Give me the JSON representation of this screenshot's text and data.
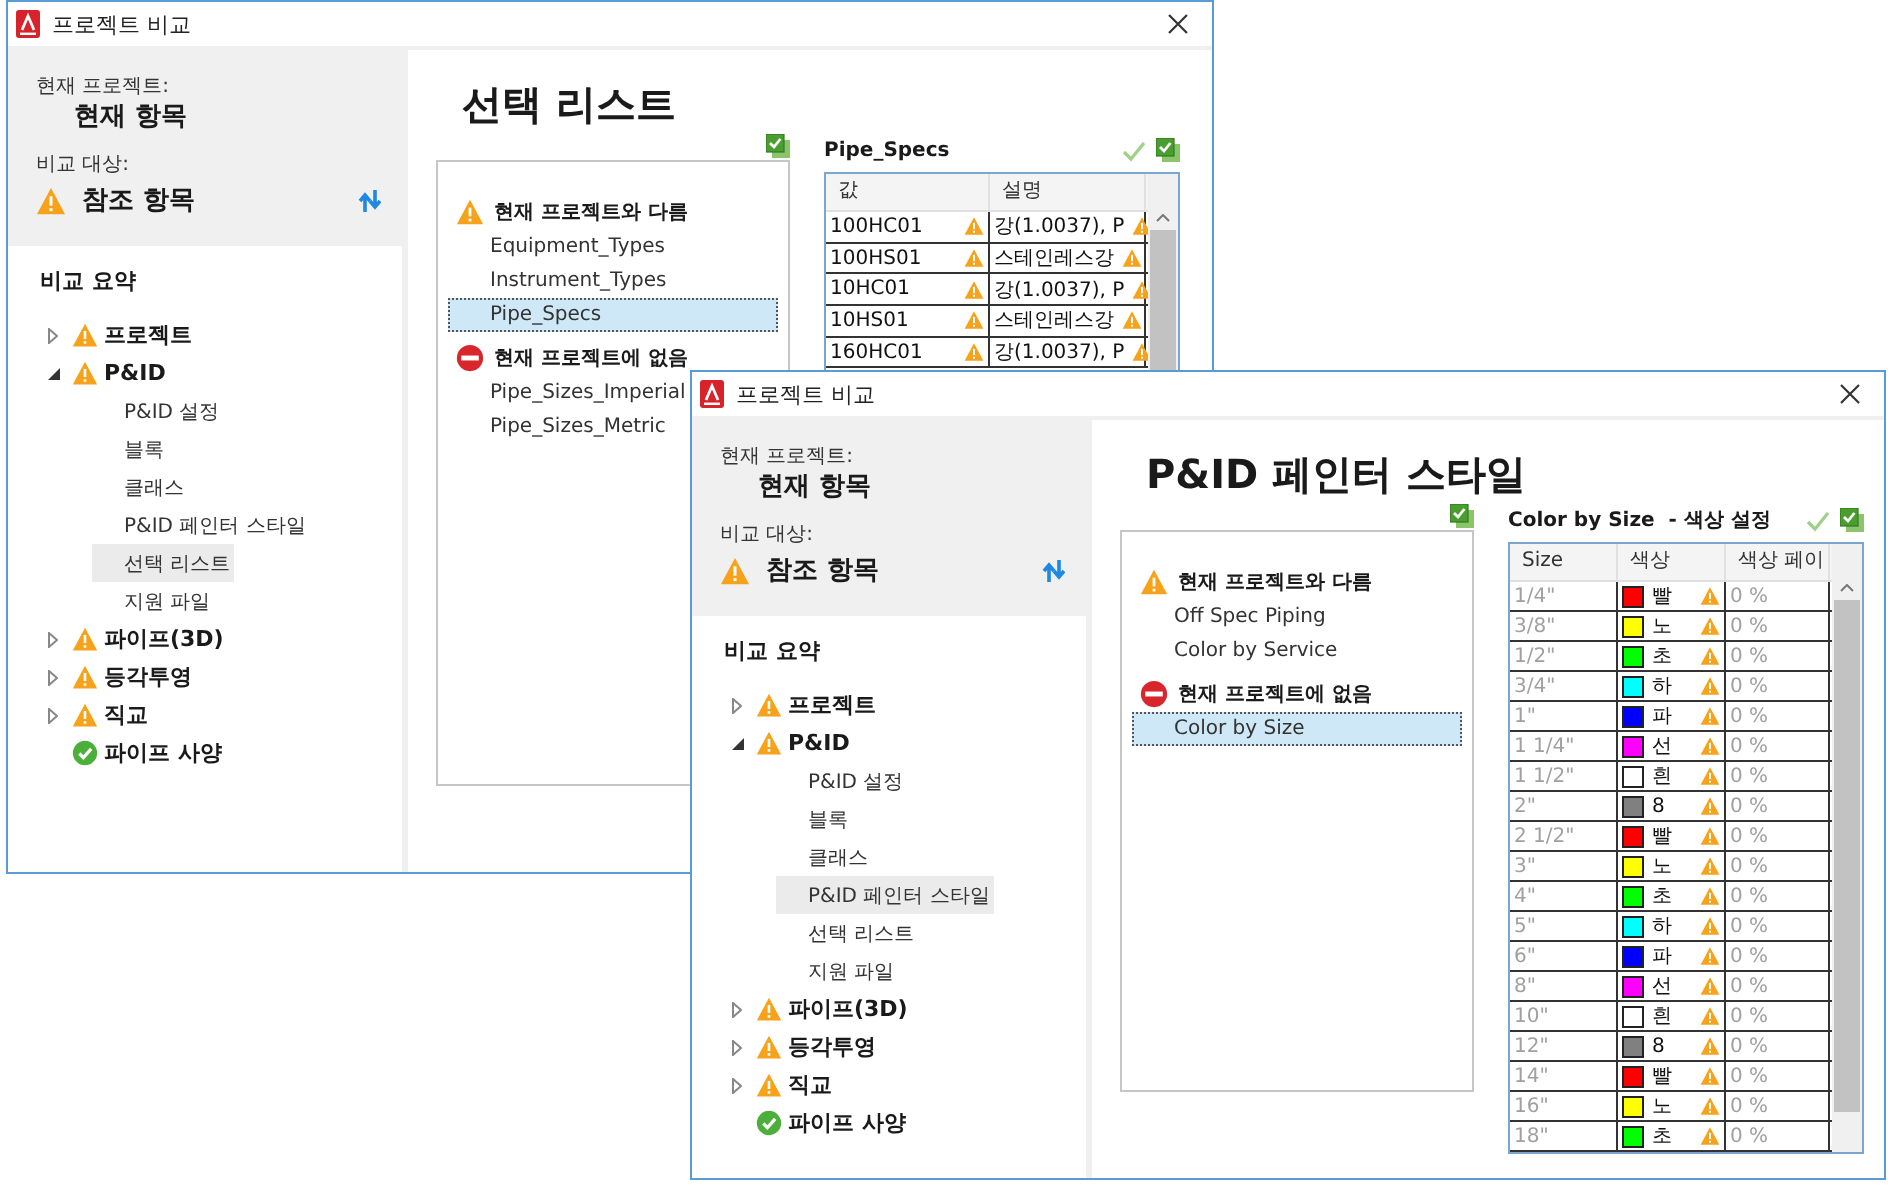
{
  "windows": [
    {
      "title": "프로젝트 비교",
      "current_label": "현재 프로젝트:",
      "current_value": "현재 항목",
      "compare_label": "비교 대상:",
      "compare_value": "참조 항목",
      "compare_warning": true,
      "summary_title": "비교 요약",
      "tree": [
        {
          "label": "프로젝트",
          "kind": "warning",
          "expanded": false
        },
        {
          "label": "P&ID",
          "kind": "warning",
          "expanded": true,
          "children": [
            {
              "label": "P&ID 설정",
              "selected": false
            },
            {
              "label": "블록",
              "selected": false
            },
            {
              "label": "클래스",
              "selected": false
            },
            {
              "label": "P&ID 페인터 스타일",
              "selected": false
            },
            {
              "label": "선택 리스트",
              "selected": true
            },
            {
              "label": "지원 파일",
              "selected": false
            }
          ]
        },
        {
          "label": "파이프(3D)",
          "kind": "warning",
          "expanded": false
        },
        {
          "label": "등각투영",
          "kind": "warning",
          "expanded": false
        },
        {
          "label": "직교",
          "kind": "warning",
          "expanded": false
        },
        {
          "label": "파이프 사양",
          "kind": "ok"
        }
      ],
      "heading": "선택 리스트",
      "list_groups": [
        {
          "kind": "warning",
          "title": "현재 프로젝트와 다름",
          "items": [
            {
              "label": "Equipment_Types",
              "selected": false
            },
            {
              "label": "Instrument_Types",
              "selected": false
            },
            {
              "label": "Pipe_Specs",
              "selected": true
            }
          ]
        },
        {
          "kind": "missing",
          "title": "현재 프로젝트에 없음",
          "items": [
            {
              "label": "Pipe_Sizes_Imperial",
              "selected": false
            },
            {
              "label": "Pipe_Sizes_Metric",
              "selected": false
            }
          ]
        }
      ],
      "detail": {
        "title": "Pipe_Specs",
        "columns": [
          "값",
          "설명"
        ],
        "rows": [
          {
            "cells": [
              {
                "text": "100HC01",
                "disabled": false,
                "warning": true
              },
              {
                "text": "강(1.0037), P",
                "disabled": false,
                "warning": true
              }
            ]
          },
          {
            "cells": [
              {
                "text": "100HS01",
                "disabled": false,
                "warning": true
              },
              {
                "text": "스테인레스강",
                "disabled": false,
                "warning": true
              }
            ]
          },
          {
            "cells": [
              {
                "text": "10HC01",
                "disabled": false,
                "warning": true
              },
              {
                "text": "강(1.0037), P",
                "disabled": false,
                "warning": true
              }
            ]
          },
          {
            "cells": [
              {
                "text": "10HS01",
                "disabled": false,
                "warning": true
              },
              {
                "text": "스테인레스강",
                "disabled": false,
                "warning": true
              }
            ]
          },
          {
            "cells": [
              {
                "text": "160HC01",
                "disabled": false,
                "warning": true
              },
              {
                "text": "강(1.0037), P",
                "disabled": false,
                "warning": true
              }
            ]
          }
        ]
      }
    },
    {
      "title": "프로젝트 비교",
      "current_label": "현재 프로젝트:",
      "current_value": "현재 항목",
      "compare_label": "비교 대상:",
      "compare_value": "참조 항목",
      "compare_warning": true,
      "summary_title": "비교 요약",
      "tree": [
        {
          "label": "프로젝트",
          "kind": "warning",
          "expanded": false
        },
        {
          "label": "P&ID",
          "kind": "warning",
          "expanded": true,
          "children": [
            {
              "label": "P&ID 설정",
              "selected": false
            },
            {
              "label": "블록",
              "selected": false
            },
            {
              "label": "클래스",
              "selected": false
            },
            {
              "label": "P&ID 페인터 스타일",
              "selected": true
            },
            {
              "label": "선택 리스트",
              "selected": false
            },
            {
              "label": "지원 파일",
              "selected": false
            }
          ]
        },
        {
          "label": "파이프(3D)",
          "kind": "warning",
          "expanded": false
        },
        {
          "label": "등각투영",
          "kind": "warning",
          "expanded": false
        },
        {
          "label": "직교",
          "kind": "warning",
          "expanded": false
        },
        {
          "label": "파이프 사양",
          "kind": "ok"
        }
      ],
      "heading": "P&ID 페인터 스타일",
      "list_groups": [
        {
          "kind": "warning",
          "title": "현재 프로젝트와 다름",
          "items": [
            {
              "label": "Off Spec Piping",
              "selected": false
            },
            {
              "label": "Color by Service",
              "selected": false
            }
          ]
        },
        {
          "kind": "missing",
          "title": "현재 프로젝트에 없음",
          "items": [
            {
              "label": "Color by Size",
              "selected": true
            }
          ]
        }
      ],
      "detail": {
        "title": "Color by Size  - 색상 설정",
        "columns": [
          "Size",
          "색상",
          "색상 페이"
        ],
        "rows": [
          {
            "cells": [
              {
                "text": "1/4\"",
                "disabled": true,
                "warning": false
              },
              {
                "text": "빨",
                "color": "#ff0000",
                "disabled": false,
                "warning": true
              },
              {
                "text": "0 %",
                "disabled": true,
                "warning": false
              }
            ]
          },
          {
            "cells": [
              {
                "text": "3/8\"",
                "disabled": true,
                "warning": false
              },
              {
                "text": "노",
                "color": "#ffff00",
                "disabled": false,
                "warning": true
              },
              {
                "text": "0 %",
                "disabled": true,
                "warning": false
              }
            ]
          },
          {
            "cells": [
              {
                "text": "1/2\"",
                "disabled": true,
                "warning": false
              },
              {
                "text": "초",
                "color": "#00ff00",
                "disabled": false,
                "warning": true
              },
              {
                "text": "0 %",
                "disabled": true,
                "warning": false
              }
            ]
          },
          {
            "cells": [
              {
                "text": "3/4\"",
                "disabled": true,
                "warning": false
              },
              {
                "text": "하",
                "color": "#00ffff",
                "disabled": false,
                "warning": true
              },
              {
                "text": "0 %",
                "disabled": true,
                "warning": false
              }
            ]
          },
          {
            "cells": [
              {
                "text": "1\"",
                "disabled": true,
                "warning": false
              },
              {
                "text": "파",
                "color": "#0000ff",
                "disabled": false,
                "warning": true
              },
              {
                "text": "0 %",
                "disabled": true,
                "warning": false
              }
            ]
          },
          {
            "cells": [
              {
                "text": "1 1/4\"",
                "disabled": true,
                "warning": false
              },
              {
                "text": "선",
                "color": "#ff00ff",
                "disabled": false,
                "warning": true
              },
              {
                "text": "0 %",
                "disabled": true,
                "warning": false
              }
            ]
          },
          {
            "cells": [
              {
                "text": "1 1/2\"",
                "disabled": true,
                "warning": false
              },
              {
                "text": "흰",
                "color": "#ffffff",
                "disabled": false,
                "warning": true
              },
              {
                "text": "0 %",
                "disabled": true,
                "warning": false
              }
            ]
          },
          {
            "cells": [
              {
                "text": "2\"",
                "disabled": true,
                "warning": false
              },
              {
                "text": "8",
                "color": "#808080",
                "disabled": false,
                "warning": true
              },
              {
                "text": "0 %",
                "disabled": true,
                "warning": false
              }
            ]
          },
          {
            "cells": [
              {
                "text": "2 1/2\"",
                "disabled": true,
                "warning": false
              },
              {
                "text": "빨",
                "color": "#ff0000",
                "disabled": false,
                "warning": true
              },
              {
                "text": "0 %",
                "disabled": true,
                "warning": false
              }
            ]
          },
          {
            "cells": [
              {
                "text": "3\"",
                "disabled": true,
                "warning": false
              },
              {
                "text": "노",
                "color": "#ffff00",
                "disabled": false,
                "warning": true
              },
              {
                "text": "0 %",
                "disabled": true,
                "warning": false
              }
            ]
          },
          {
            "cells": [
              {
                "text": "4\"",
                "disabled": true,
                "warning": false
              },
              {
                "text": "초",
                "color": "#00ff00",
                "disabled": false,
                "warning": true
              },
              {
                "text": "0 %",
                "disabled": true,
                "warning": false
              }
            ]
          },
          {
            "cells": [
              {
                "text": "5\"",
                "disabled": true,
                "warning": false
              },
              {
                "text": "하",
                "color": "#00ffff",
                "disabled": false,
                "warning": true
              },
              {
                "text": "0 %",
                "disabled": true,
                "warning": false
              }
            ]
          },
          {
            "cells": [
              {
                "text": "6\"",
                "disabled": true,
                "warning": false
              },
              {
                "text": "파",
                "color": "#0000ff",
                "disabled": false,
                "warning": true
              },
              {
                "text": "0 %",
                "disabled": true,
                "warning": false
              }
            ]
          },
          {
            "cells": [
              {
                "text": "8\"",
                "disabled": true,
                "warning": false
              },
              {
                "text": "선",
                "color": "#ff00ff",
                "disabled": false,
                "warning": true
              },
              {
                "text": "0 %",
                "disabled": true,
                "warning": false
              }
            ]
          },
          {
            "cells": [
              {
                "text": "10\"",
                "disabled": true,
                "warning": false
              },
              {
                "text": "흰",
                "color": "#ffffff",
                "disabled": false,
                "warning": true
              },
              {
                "text": "0 %",
                "disabled": true,
                "warning": false
              }
            ]
          },
          {
            "cells": [
              {
                "text": "12\"",
                "disabled": true,
                "warning": false
              },
              {
                "text": "8",
                "color": "#808080",
                "disabled": false,
                "warning": true
              },
              {
                "text": "0 %",
                "disabled": true,
                "warning": false
              }
            ]
          },
          {
            "cells": [
              {
                "text": "14\"",
                "disabled": true,
                "warning": false
              },
              {
                "text": "빨",
                "color": "#ff0000",
                "disabled": false,
                "warning": true
              },
              {
                "text": "0 %",
                "disabled": true,
                "warning": false
              }
            ]
          },
          {
            "cells": [
              {
                "text": "16\"",
                "disabled": true,
                "warning": false
              },
              {
                "text": "노",
                "color": "#ffff00",
                "disabled": false,
                "warning": true
              },
              {
                "text": "0 %",
                "disabled": true,
                "warning": false
              }
            ]
          },
          {
            "cells": [
              {
                "text": "18\"",
                "disabled": true,
                "warning": false
              },
              {
                "text": "초",
                "color": "#00ff00",
                "disabled": false,
                "warning": true
              },
              {
                "text": "0 %",
                "disabled": true,
                "warning": false
              }
            ]
          }
        ]
      }
    }
  ]
}
